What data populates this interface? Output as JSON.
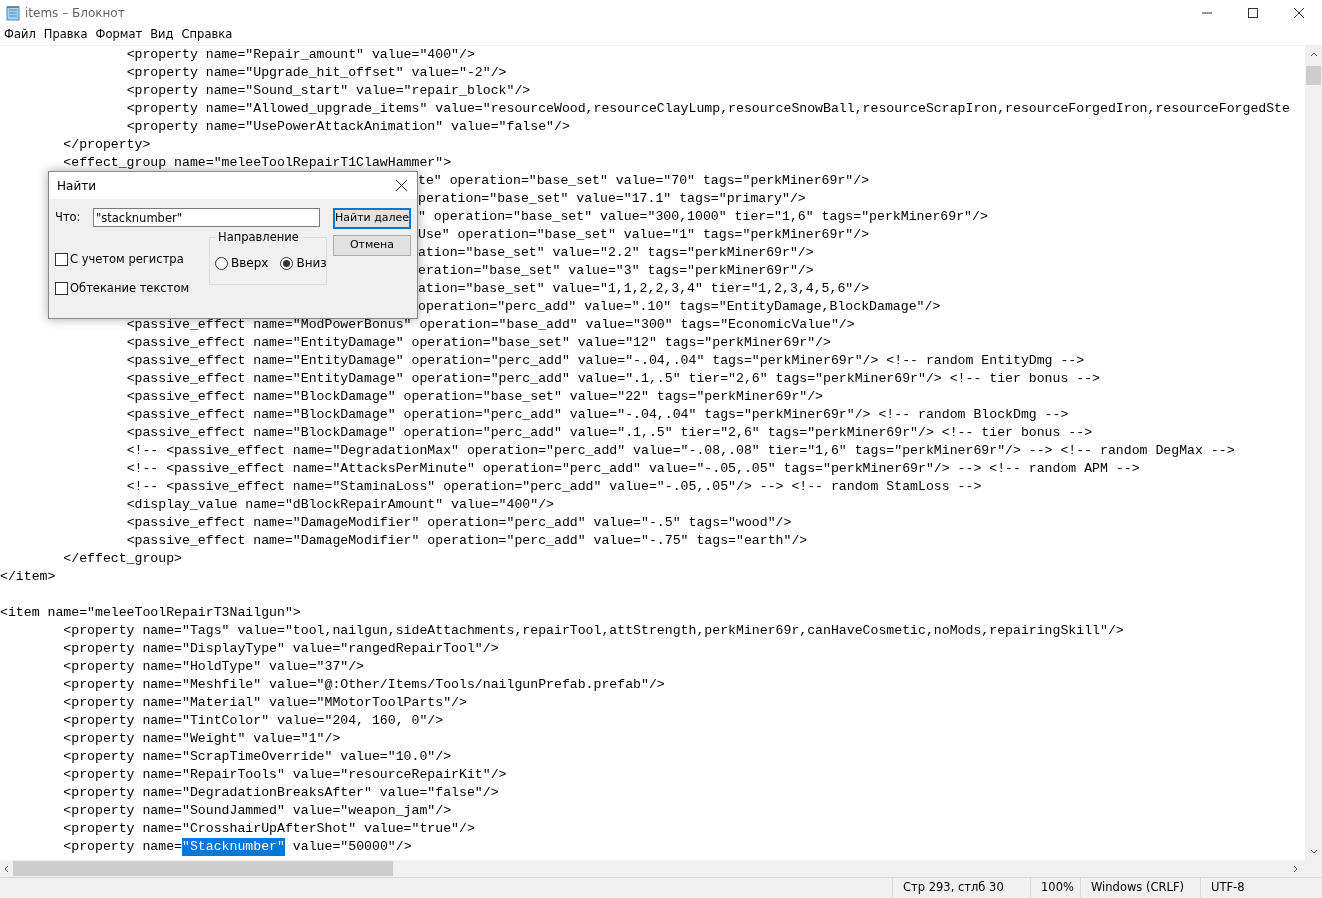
{
  "window": {
    "title": "items – Блокнот"
  },
  "menu": [
    "Файл",
    "Правка",
    "Формат",
    "Вид",
    "Справка"
  ],
  "editor": {
    "lines": [
      {
        "kind": "code",
        "text": "\t\t<property name=\"Repair_amount\" value=\"400\"/>"
      },
      {
        "kind": "code",
        "text": "\t\t<property name=\"Upgrade_hit_offset\" value=\"-2\"/>"
      },
      {
        "kind": "code",
        "text": "\t\t<property name=\"Sound_start\" value=\"repair_block\"/>"
      },
      {
        "kind": "code",
        "text": "\t\t<property name=\"Allowed_upgrade_items\" value=\"resourceWood,resourceClayLump,resourceSnowBall,resourceScrapIron,resourceForgedIron,resourceForgedSte"
      },
      {
        "kind": "code",
        "text": "\t\t<property name=\"UsePowerAttackAnimation\" value=\"false\"/>"
      },
      {
        "kind": "code",
        "text": "\t</property>"
      },
      {
        "kind": "code",
        "text": "\t<effect_group name=\"meleeToolRepairT1ClawHammer\">"
      },
      {
        "kind": "covered",
        "text": "te\" operation=\"base_set\" value=\"70\" tags=\"perkMiner69r\"/>"
      },
      {
        "kind": "covered",
        "text": "peration=\"base_set\" value=\"17.1\" tags=\"primary\"/>"
      },
      {
        "kind": "covered",
        "text": "\" operation=\"base_set\" value=\"300,1000\" tier=\"1,6\" tags=\"perkMiner69r\"/>"
      },
      {
        "kind": "covered",
        "text": "Use\" operation=\"base_set\" value=\"1\" tags=\"perkMiner69r\"/>"
      },
      {
        "kind": "covered",
        "text": "ation=\"base_set\" value=\"2.2\" tags=\"perkMiner69r\"/>"
      },
      {
        "kind": "covered",
        "text": "eration=\"base_set\" value=\"3\" tags=\"perkMiner69r\"/>"
      },
      {
        "kind": "covered",
        "text": "ation=\"base_set\" value=\"1,1,2,2,3,4\" tier=\"1,2,3,4,5,6\"/>"
      },
      {
        "kind": "covered",
        "text": "operation=\"perc_add\" value=\".10\" tags=\"EntityDamage,BlockDamage\"/>"
      },
      {
        "kind": "code",
        "text": "\t\t<passive_effect name=\"ModPowerBonus\" operation=\"base_add\" value=\"300\" tags=\"EconomicValue\"/>"
      },
      {
        "kind": "code",
        "text": "\t\t<passive_effect name=\"EntityDamage\" operation=\"base_set\" value=\"12\" tags=\"perkMiner69r\"/>"
      },
      {
        "kind": "code",
        "text": "\t\t<passive_effect name=\"EntityDamage\" operation=\"perc_add\" value=\"-.04,.04\" tags=\"perkMiner69r\"/> <!-- random EntityDmg -->"
      },
      {
        "kind": "code",
        "text": "\t\t<passive_effect name=\"EntityDamage\" operation=\"perc_add\" value=\".1,.5\" tier=\"2,6\" tags=\"perkMiner69r\"/> <!-- tier bonus -->"
      },
      {
        "kind": "code",
        "text": "\t\t<passive_effect name=\"BlockDamage\" operation=\"base_set\" value=\"22\" tags=\"perkMiner69r\"/>"
      },
      {
        "kind": "code",
        "text": "\t\t<passive_effect name=\"BlockDamage\" operation=\"perc_add\" value=\"-.04,.04\" tags=\"perkMiner69r\"/> <!-- random BlockDmg -->"
      },
      {
        "kind": "code",
        "text": "\t\t<passive_effect name=\"BlockDamage\" operation=\"perc_add\" value=\".1,.5\" tier=\"2,6\" tags=\"perkMiner69r\"/> <!-- tier bonus -->"
      },
      {
        "kind": "code",
        "text": "\t\t<!-- <passive_effect name=\"DegradationMax\" operation=\"perc_add\" value=\"-.08,.08\" tier=\"1,6\" tags=\"perkMiner69r\"/> --> <!-- random DegMax -->"
      },
      {
        "kind": "code",
        "text": "\t\t<!-- <passive_effect name=\"AttacksPerMinute\" operation=\"perc_add\" value=\"-.05,.05\" tags=\"perkMiner69r\"/> --> <!-- random APM -->"
      },
      {
        "kind": "code",
        "text": "\t\t<!-- <passive_effect name=\"StaminaLoss\" operation=\"perc_add\" value=\"-.05,.05\"/> --> <!-- random StamLoss -->"
      },
      {
        "kind": "code",
        "text": "\t\t<display_value name=\"dBlockRepairAmount\" value=\"400\"/>"
      },
      {
        "kind": "code",
        "text": "\t\t<passive_effect name=\"DamageModifier\" operation=\"perc_add\" value=\"-.5\" tags=\"wood\"/>"
      },
      {
        "kind": "code",
        "text": "\t\t<passive_effect name=\"DamageModifier\" operation=\"perc_add\" value=\"-.75\" tags=\"earth\"/>"
      },
      {
        "kind": "code",
        "text": "\t</effect_group>"
      },
      {
        "kind": "code",
        "text": "</item>"
      },
      {
        "kind": "blank"
      },
      {
        "kind": "code",
        "text": "<item name=\"meleeToolRepairT3Nailgun\">"
      },
      {
        "kind": "code",
        "text": "\t<property name=\"Tags\" value=\"tool,nailgun,sideAttachments,repairTool,attStrength,perkMiner69r,canHaveCosmetic,noMods,repairingSkill\"/>"
      },
      {
        "kind": "code",
        "text": "\t<property name=\"DisplayType\" value=\"rangedRepairTool\"/>"
      },
      {
        "kind": "code",
        "text": "\t<property name=\"HoldType\" value=\"37\"/>"
      },
      {
        "kind": "code",
        "text": "\t<property name=\"Meshfile\" value=\"@:Other/Items/Tools/nailgunPrefab.prefab\"/>"
      },
      {
        "kind": "code",
        "text": "\t<property name=\"Material\" value=\"MMotorToolParts\"/>"
      },
      {
        "kind": "code",
        "text": "\t<property name=\"TintColor\" value=\"204, 160, 0\"/>"
      },
      {
        "kind": "code",
        "text": "\t<property name=\"Weight\" value=\"1\"/>"
      },
      {
        "kind": "code",
        "text": "\t<property name=\"ScrapTimeOverride\" value=\"10.0\"/>"
      },
      {
        "kind": "code",
        "text": "\t<property name=\"RepairTools\" value=\"resourceRepairKit\"/>"
      },
      {
        "kind": "code",
        "text": "\t<property name=\"DegradationBreaksAfter\" value=\"false\"/>"
      },
      {
        "kind": "code",
        "text": "\t<property name=\"SoundJammed\" value=\"weapon_jam\"/>"
      },
      {
        "kind": "code",
        "text": "\t<property name=\"CrosshairUpAfterShot\" value=\"true\"/>"
      },
      {
        "kind": "selection",
        "before": "\t<property name=",
        "selected": "\"Stacknumber\"",
        "after": " value=\"50000\"/>"
      }
    ]
  },
  "find_dialog": {
    "title": "Найти",
    "what_label": "Что:",
    "what_value": "\"stacknumber\"",
    "find_next": "Найти далее",
    "cancel": "Отмена",
    "direction_label": "Направление",
    "directions": [
      {
        "label": "Вверх",
        "selected": false
      },
      {
        "label": "Вниз",
        "selected": true
      }
    ],
    "options": [
      {
        "label": "С учетом регистра",
        "checked": false
      },
      {
        "label": "Обтекание текстом",
        "checked": false
      }
    ]
  },
  "status_bar": [
    "Стр 293, стлб 30",
    "100%",
    "Windows (CRLF)",
    "UTF-8"
  ]
}
